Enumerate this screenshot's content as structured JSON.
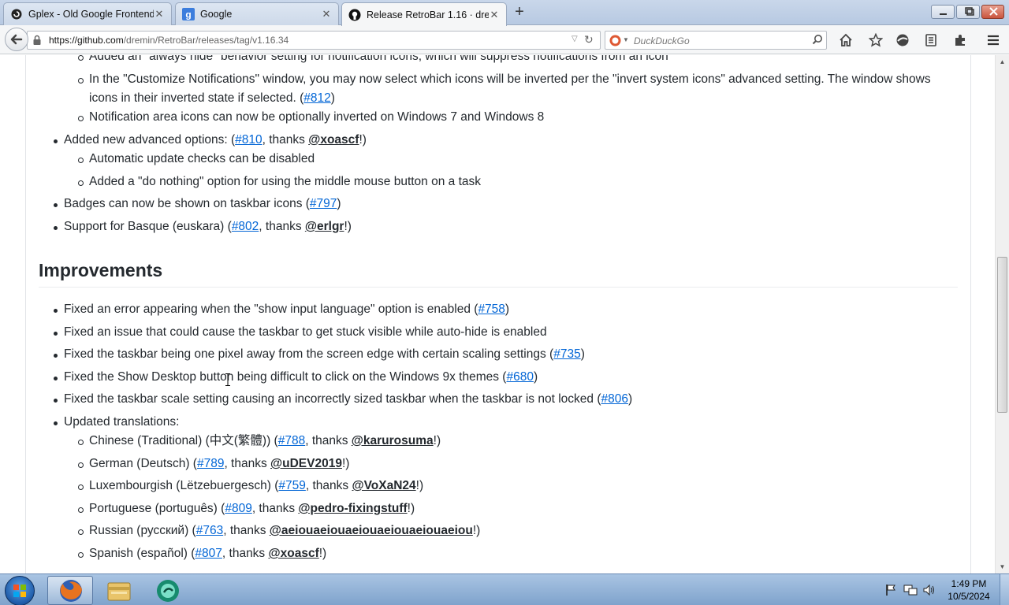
{
  "browser": {
    "tabs": [
      {
        "title": "Gplex - Old Google Frontend",
        "favicon": "gplex-favicon-icon"
      },
      {
        "title": "Google",
        "favicon": "google-favicon-icon"
      },
      {
        "title": "Release RetroBar 1.16 · dre...",
        "favicon": "github-favicon-icon"
      }
    ],
    "url_host": "https://github.com",
    "url_path": "/dremin/RetroBar/releases/tag/v1.16.34",
    "search_placeholder": "DuckDuckGo"
  },
  "page": {
    "top_items": [
      {
        "level": 2,
        "parts": [
          {
            "t": "Added an \"always hide\" behavior setting for notification icons, which will suppress notifications from an icon"
          }
        ]
      },
      {
        "level": 2,
        "parts": [
          {
            "t": "In the \"Customize Notifications\" window, you may now select which icons will be inverted per the \"invert system icons\" advanced setting. The window shows"
          }
        ]
      },
      {
        "level": 2,
        "cont": true,
        "parts": [
          {
            "t": "icons in their inverted state if selected. ("
          },
          {
            "link": "#812"
          },
          {
            "t": ")"
          }
        ]
      },
      {
        "level": 2,
        "parts": [
          {
            "t": "Notification area icons can now be optionally inverted on Windows 7 and Windows 8"
          }
        ]
      },
      {
        "level": 1,
        "parts": [
          {
            "t": "Added new advanced options: ("
          },
          {
            "link": "#810"
          },
          {
            "t": ", thanks "
          },
          {
            "mention": "@xoascf"
          },
          {
            "t": "!)"
          }
        ]
      },
      {
        "level": 2,
        "parts": [
          {
            "t": "Automatic update checks can be disabled"
          }
        ]
      },
      {
        "level": 2,
        "parts": [
          {
            "t": "Added a \"do nothing\" option for using the middle mouse button on a task"
          }
        ]
      },
      {
        "level": 1,
        "parts": [
          {
            "t": "Badges can now be shown on taskbar icons ("
          },
          {
            "link": "#797"
          },
          {
            "t": ")"
          }
        ]
      },
      {
        "level": 1,
        "parts": [
          {
            "t": "Support for Basque (euskara) ("
          },
          {
            "link": "#802"
          },
          {
            "t": ", thanks "
          },
          {
            "mention": "@erlgr"
          },
          {
            "t": "!)"
          }
        ]
      }
    ],
    "improvements_heading": "Improvements",
    "improvement_items": [
      {
        "level": 1,
        "parts": [
          {
            "t": "Fixed an error appearing when the \"show input language\" option is enabled ("
          },
          {
            "link": "#758"
          },
          {
            "t": ")"
          }
        ]
      },
      {
        "level": 1,
        "parts": [
          {
            "t": "Fixed an issue that could cause the taskbar to get stuck visible while auto-hide is enabled"
          }
        ]
      },
      {
        "level": 1,
        "parts": [
          {
            "t": "Fixed the taskbar being one pixel away from the screen edge with certain scaling settings ("
          },
          {
            "link": "#735"
          },
          {
            "t": ")"
          }
        ]
      },
      {
        "level": 1,
        "parts": [
          {
            "t": "Fixed the Show Desktop button being difficult to click on the Windows 9x themes ("
          },
          {
            "link": "#680"
          },
          {
            "t": ")"
          }
        ]
      },
      {
        "level": 1,
        "parts": [
          {
            "t": "Fixed the taskbar scale setting causing an incorrectly sized taskbar when the taskbar is not locked ("
          },
          {
            "link": "#806"
          },
          {
            "t": ")"
          }
        ]
      },
      {
        "level": 1,
        "parts": [
          {
            "t": "Updated translations:"
          }
        ]
      },
      {
        "level": 2,
        "parts": [
          {
            "t": "Chinese (Traditional) (中文(繁體)) ("
          },
          {
            "link": "#788"
          },
          {
            "t": ", thanks "
          },
          {
            "mention": "@karurosuma"
          },
          {
            "t": "!)"
          }
        ]
      },
      {
        "level": 2,
        "parts": [
          {
            "t": "German (Deutsch) ("
          },
          {
            "link": "#789"
          },
          {
            "t": ", thanks "
          },
          {
            "mention": "@uDEV2019"
          },
          {
            "t": "!)"
          }
        ]
      },
      {
        "level": 2,
        "parts": [
          {
            "t": "Luxembourgish (Lëtzebuergesch) ("
          },
          {
            "link": "#759"
          },
          {
            "t": ", thanks "
          },
          {
            "mention": "@VoXaN24"
          },
          {
            "t": "!)"
          }
        ]
      },
      {
        "level": 2,
        "parts": [
          {
            "t": "Portuguese (português) ("
          },
          {
            "link": "#809"
          },
          {
            "t": ", thanks "
          },
          {
            "mention": "@pedro-fixingstuff"
          },
          {
            "t": "!)"
          }
        ]
      },
      {
        "level": 2,
        "parts": [
          {
            "t": "Russian (русский) ("
          },
          {
            "link": "#763"
          },
          {
            "t": ", thanks "
          },
          {
            "mention": "@aeiouaeiouaeiouaeiouaeiouaeiou"
          },
          {
            "t": "!)"
          }
        ]
      },
      {
        "level": 2,
        "parts": [
          {
            "t": "Spanish (español) ("
          },
          {
            "link": "#807"
          },
          {
            "t": ", thanks "
          },
          {
            "mention": "@xoascf"
          },
          {
            "t": "!)"
          }
        ]
      }
    ]
  },
  "taskbar": {
    "apps": [
      "firefox-icon",
      "file-explorer-icon",
      "messenger-icon"
    ],
    "clock_time": "1:49 PM",
    "clock_date": "10/5/2024"
  },
  "colors": {
    "link": "#0366d6",
    "text": "#24292e",
    "taskbar": "#7fa3cc"
  }
}
